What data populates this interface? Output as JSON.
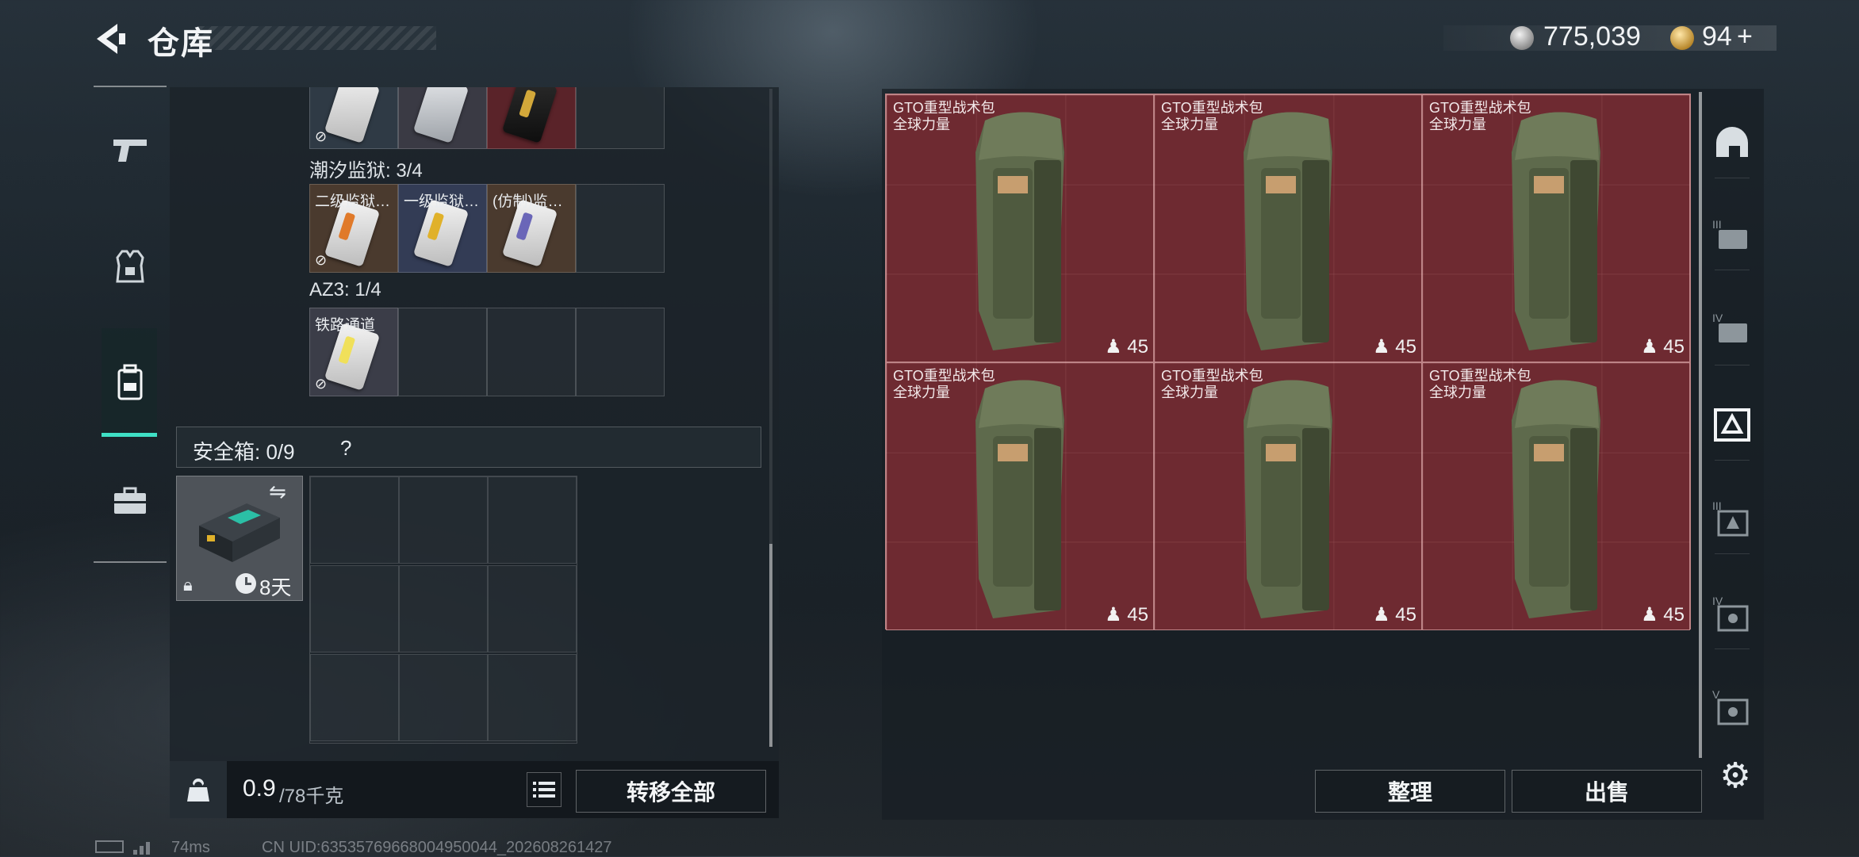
{
  "header": {
    "title": "仓库",
    "currency_silver": "775,039",
    "currency_gold": "94",
    "currency_gold_plus": "+"
  },
  "left_nav": {
    "items": [
      {
        "name": "weapons",
        "icon": "pistol-icon"
      },
      {
        "name": "equipment",
        "icon": "armor-icon"
      },
      {
        "name": "backpack",
        "icon": "backpack-icon",
        "active": true
      },
      {
        "name": "case",
        "icon": "briefcase-icon"
      }
    ]
  },
  "cards": {
    "row0": [
      {
        "name": ""
      },
      {
        "name": ""
      },
      {
        "name": ""
      }
    ],
    "section1_label": "潮汐监狱: 3/4",
    "row1": [
      {
        "name": "二级监狱…"
      },
      {
        "name": "一级监狱…"
      },
      {
        "name": "(仿制)监…"
      }
    ],
    "section2_label": "AZ3: 1/4",
    "row2": [
      {
        "name": "铁路通道"
      }
    ]
  },
  "safe_box": {
    "label": "安全箱: 0/9",
    "help": "?",
    "timer": "8天"
  },
  "bottom": {
    "weight_current": "0.9",
    "weight_max": "/78千克",
    "transfer_all": "转移全部"
  },
  "stash": {
    "items": [
      {
        "name": "GTO重型战术包",
        "subtitle": "全球力量",
        "count": "45"
      },
      {
        "name": "GTO重型战术包",
        "subtitle": "全球力量",
        "count": "45"
      },
      {
        "name": "GTO重型战术包",
        "subtitle": "全球力量",
        "count": "45"
      },
      {
        "name": "GTO重型战术包",
        "subtitle": "全球力量",
        "count": "45"
      },
      {
        "name": "GTO重型战术包",
        "subtitle": "全球力量",
        "count": "45"
      },
      {
        "name": "GTO重型战术包",
        "subtitle": "全球力量",
        "count": "45"
      }
    ],
    "sort_button": "整理",
    "sell_button": "出售"
  },
  "right_rail": {
    "labels": [
      "",
      "III",
      "IV",
      "",
      "III",
      "IV",
      "V"
    ]
  },
  "footer": {
    "ping": "74ms",
    "uid": "CN UID:63535769668004950044_202608261427"
  },
  "colors": {
    "accent": "#3fe0c5",
    "stash_bg": "#6e2a31"
  }
}
